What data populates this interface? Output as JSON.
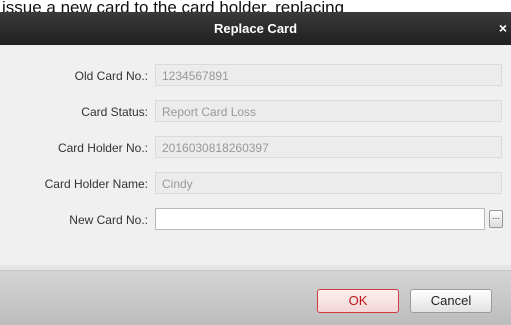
{
  "background_text": "issue a new card to the card holder. replacing",
  "dialog": {
    "title": "Replace Card",
    "close_glyph": "×",
    "fields": [
      {
        "label": "Old Card No.:",
        "value": "1234567891"
      },
      {
        "label": "Card Status:",
        "value": "Report Card Loss"
      },
      {
        "label": "Card Holder No.:",
        "value": "2016030818260397"
      },
      {
        "label": "Card Holder Name:",
        "value": "Cindy"
      },
      {
        "label": "New Card No.:",
        "value": ""
      }
    ],
    "browse_label": "...",
    "ok_label": "OK",
    "cancel_label": "Cancel"
  },
  "colors": {
    "titlebar": "#2b2b2b",
    "ok_border": "#d23c3c",
    "ok_text": "#c01818"
  }
}
